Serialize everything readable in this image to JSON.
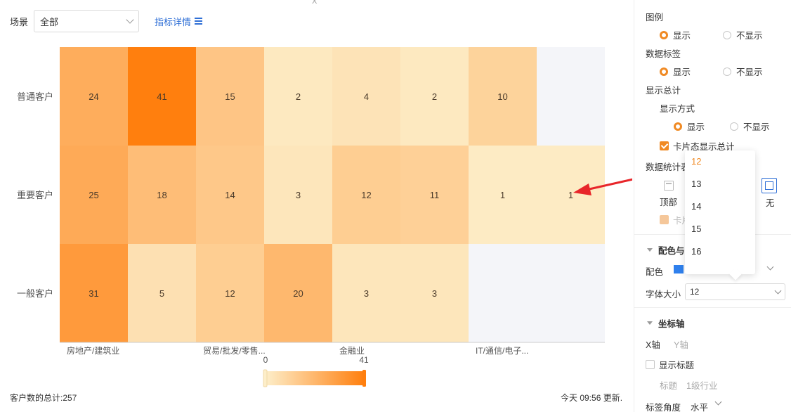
{
  "header": {
    "scene_label": "场景",
    "scene_value": "全部",
    "metric_link": "指标详情",
    "top_mark": "X"
  },
  "chart_data": {
    "type": "heatmap",
    "rows": [
      "普通客户",
      "重要客户",
      "一般客户"
    ],
    "columns": [
      "房地产/建筑业",
      "",
      "贸易/批发/零售...",
      "",
      "金融业",
      "",
      "IT/通信/电子...",
      ""
    ],
    "xtick_labels": [
      "房地产/建筑业",
      "贸易/批发/零售...",
      "金融业",
      "IT/通信/电子..."
    ],
    "values": [
      [
        24,
        41,
        15,
        2,
        4,
        2,
        10,
        null
      ],
      [
        25,
        18,
        14,
        3,
        12,
        11,
        1,
        1
      ],
      [
        31,
        5,
        12,
        20,
        3,
        3,
        null,
        null
      ]
    ],
    "color_range": [
      0,
      41
    ],
    "color_scale": [
      "#fdeec9",
      "#ff7f0e"
    ],
    "empty_color": "#f4f5f9",
    "legend_min_label": "0",
    "legend_max_label": "41",
    "legend_position": "bottom-center",
    "grid": false
  },
  "footer": {
    "total": "客户数的总计:257",
    "updated": "今天 09:56 更新."
  },
  "panel": {
    "legend_title": "图例",
    "legend_show": "显示",
    "legend_hide": "不显示",
    "label_title": "数据标签",
    "label_show": "显示",
    "label_hide": "不显示",
    "total_title": "显示总计",
    "display_mode": "显示方式",
    "mode_show": "显示",
    "mode_hide": "不显示",
    "card_total": "卡片态显示总计",
    "stats_title": "数据统计表",
    "pos_top": "顶部",
    "pos_none": "无",
    "card_disabled": "卡片",
    "color_section": "配色与",
    "color_label": "配色",
    "font_size_label": "字体大小",
    "font_size_value": "12",
    "axis_section": "坐标轴",
    "x_axis_tab": "X轴",
    "y_axis_tab": "Y轴",
    "show_title": "显示标题",
    "title_label": "标题",
    "title_value": "1级行业",
    "angle_label": "标签角度",
    "angle_value": "水平",
    "accent": "#f08a24"
  },
  "dropdown": {
    "options": [
      "12",
      "13",
      "14",
      "15",
      "16"
    ],
    "selected": "12"
  }
}
